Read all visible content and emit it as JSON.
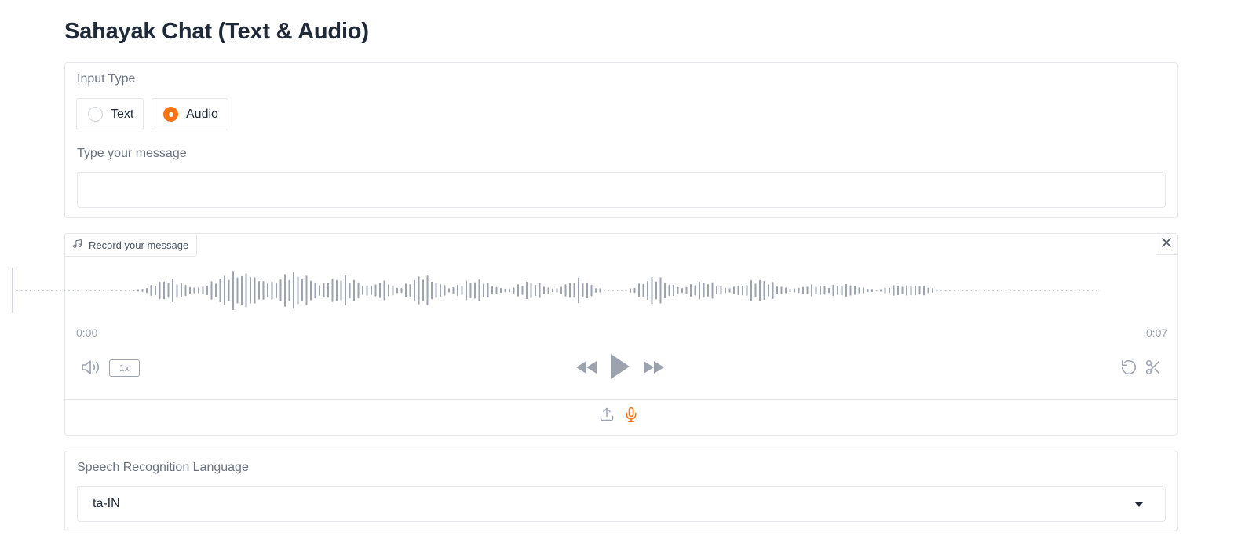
{
  "app": {
    "title": "Sahayak Chat (Text & Audio)"
  },
  "input_type": {
    "label": "Input Type",
    "options": [
      {
        "label": "Text",
        "selected": false
      },
      {
        "label": "Audio",
        "selected": true
      }
    ]
  },
  "message": {
    "label": "Type your message",
    "value": "",
    "placeholder": ""
  },
  "audio": {
    "label": "Record your message",
    "current_time": "0:00",
    "duration": "0:07",
    "playback_rate": "1x",
    "playback_progress": 0,
    "sources": [
      "upload",
      "microphone"
    ],
    "active_source": "microphone",
    "waveform_color": "#9ca3af",
    "accent_color": "#f97316"
  },
  "language": {
    "label": "Speech Recognition Language",
    "selected": "ta-IN"
  },
  "icons": {
    "audio_tag": "music-note-icon",
    "close": "close-icon",
    "volume": "volume-icon",
    "skip_back": "skip-backward-icon",
    "play": "play-icon",
    "skip_forward": "skip-forward-icon",
    "reset": "undo-icon",
    "trim": "scissors-icon",
    "upload": "upload-icon",
    "microphone": "microphone-icon",
    "dropdown": "caret-down-icon"
  }
}
